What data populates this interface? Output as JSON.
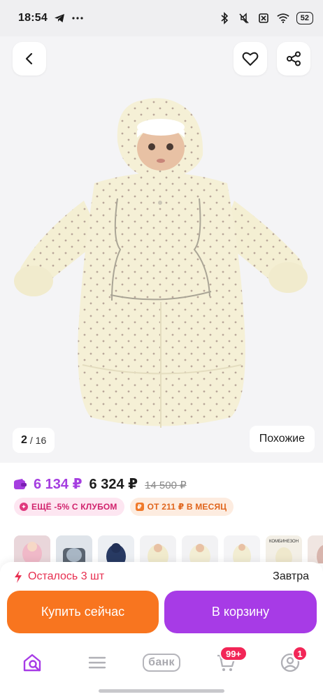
{
  "status_bar": {
    "time": "18:54",
    "battery": "52",
    "left_icons": [
      "telegram-icon",
      "more-dots-icon"
    ],
    "right_icons": [
      "bluetooth-icon",
      "mute-icon",
      "sim-off-icon",
      "wifi-icon",
      "battery-icon"
    ]
  },
  "hero": {
    "back_icon": "chevron-left-icon",
    "favorite_icon": "heart-icon",
    "share_icon": "share-icon",
    "counter_current": "2",
    "counter_total": "/ 16",
    "similar_label": "Похожие"
  },
  "price": {
    "wallet_price": "6 134 ₽",
    "price": "6 324 ₽",
    "old_price": "14 500 ₽",
    "wallet_color": "#a53ee0"
  },
  "badges": [
    {
      "label": "ЕЩЁ -5% С КЛУБОМ",
      "icon": "club-icon",
      "color": "#d1236d"
    },
    {
      "label": "ОТ 211 ₽ В МЕСЯЦ",
      "icon": "installment-icon",
      "color": "#e0651d"
    }
  ],
  "thumbnails": [
    {
      "name": "thumb-1"
    },
    {
      "name": "thumb-2"
    },
    {
      "name": "thumb-3"
    },
    {
      "name": "thumb-4"
    },
    {
      "name": "thumb-5"
    },
    {
      "name": "thumb-6"
    },
    {
      "name": "thumb-7",
      "label": "КОМБИНЕЗОН"
    },
    {
      "name": "thumb-8"
    }
  ],
  "purchase": {
    "stock_text": "Осталось 3 шт",
    "delivery_text": "Завтра",
    "buy_now_label": "Купить сейчас",
    "add_to_cart_label": "В корзину",
    "buy_color": "#f8751f",
    "cart_color": "#a73be6"
  },
  "tabbar": {
    "items": [
      {
        "name": "home",
        "icon": "home-search-icon"
      },
      {
        "name": "catalog",
        "icon": "menu-icon"
      },
      {
        "name": "bank",
        "label": "банк"
      },
      {
        "name": "cart",
        "icon": "cart-icon",
        "badge": "99+"
      },
      {
        "name": "profile",
        "icon": "profile-icon",
        "badge": "1"
      }
    ]
  }
}
